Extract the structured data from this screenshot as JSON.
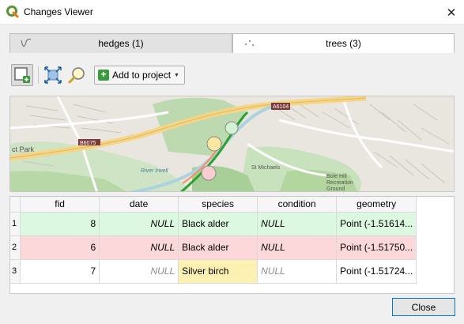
{
  "window": {
    "title": "Changes Viewer",
    "close_glyph": "✕"
  },
  "tabs": [
    {
      "label": "hedges (1)",
      "icon": "line-layer-icon",
      "active": false
    },
    {
      "label": "trees (3)",
      "icon": "point-layer-icon",
      "active": true
    }
  ],
  "toolbar": {
    "toggle_map_icon": "map-panel-icon",
    "zoom_full_icon": "zoom-full-icon",
    "zoom_selected_icon": "zoom-selected-icon",
    "add_to_project_label": "Add to project"
  },
  "map": {
    "labels": [
      "A6104",
      "ct Park",
      "B6075",
      "St Michaels",
      "Bole Hill",
      "Recreation",
      "Ground",
      "River Irwell"
    ]
  },
  "table": {
    "columns": [
      "fid",
      "date",
      "species",
      "condition",
      "geometry"
    ],
    "rows": [
      {
        "num": "1",
        "fid": "8",
        "date": "NULL",
        "species": "Black alder",
        "condition": "NULL",
        "geometry": "Point (-1.51614...",
        "status": "added",
        "color": "#dcf8e0"
      },
      {
        "num": "2",
        "fid": "6",
        "date": "NULL",
        "species": "Black alder",
        "condition": "NULL",
        "geometry": "Point (-1.51750...",
        "status": "deleted",
        "color": "#fcd8da"
      },
      {
        "num": "3",
        "fid": "7",
        "date": "NULL",
        "species": "Silver birch",
        "condition": "NULL",
        "geometry": "Point (-1.51724...",
        "status": "modified",
        "color": "#ffffff",
        "changed_cell_color": "#fdf0b3"
      }
    ]
  },
  "buttons": {
    "close_label": "Close"
  },
  "colors": {
    "added": "#dcf8e0",
    "deleted": "#fcd8da",
    "modified": "#fdf0b3",
    "accent": "#0078d7"
  }
}
